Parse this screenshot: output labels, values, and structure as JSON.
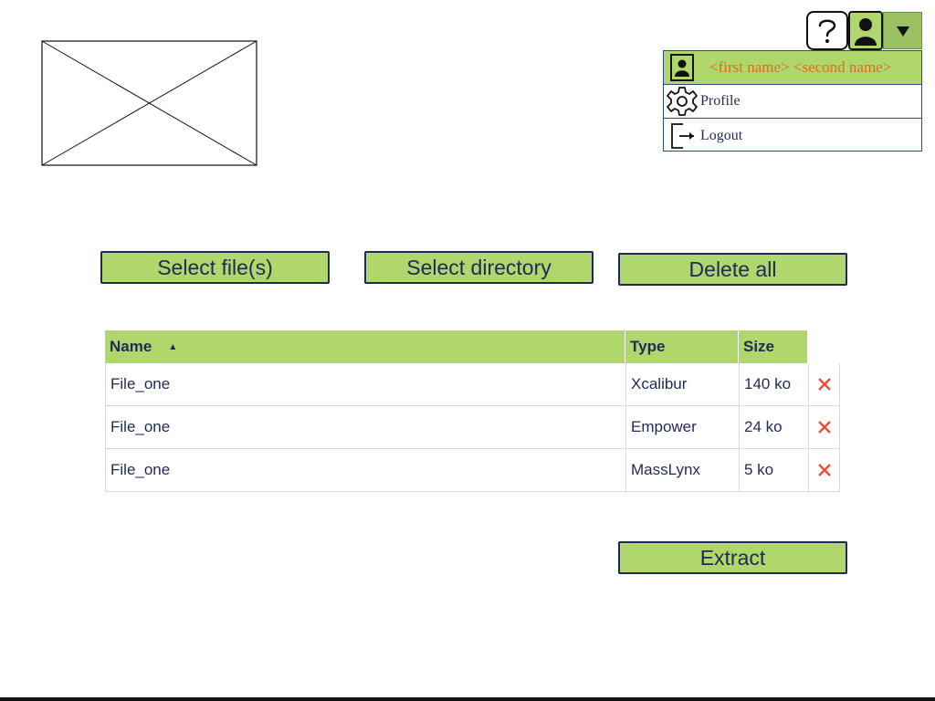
{
  "header": {
    "logo_icon": "image-placeholder-icon",
    "help_icon": "help-question-icon",
    "user_icon": "user-avatar-icon",
    "menu_toggle_icon": "caret-down-icon"
  },
  "user_menu": {
    "user_label": "<first name> <second name>",
    "profile_label": "Profile",
    "logout_label": "Logout"
  },
  "actions": {
    "select_files": "Select file(s)",
    "select_directory": "Select directory",
    "delete_all": "Delete all",
    "extract": "Extract"
  },
  "table": {
    "columns": [
      "Name",
      "Type",
      "Size"
    ],
    "sort_column": "Name",
    "sort_direction": "ascending",
    "rows": [
      {
        "name": "File_one",
        "type": "Xcalibur",
        "size": "140 ko"
      },
      {
        "name": "File_one",
        "type": "Empower",
        "size": "24 ko"
      },
      {
        "name": "File_one",
        "type": "MassLynx",
        "size": "5 ko"
      }
    ],
    "delete_icon": "close-x-icon"
  },
  "colors": {
    "accent": "#b0d76b",
    "text": "#1f2a55",
    "orange": "#e06b1f",
    "delete": "#e8503a"
  }
}
